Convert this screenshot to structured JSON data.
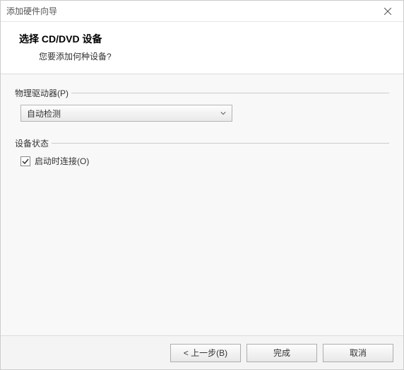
{
  "window": {
    "title": "添加硬件向导"
  },
  "header": {
    "title": "选择 CD/DVD 设备",
    "subtitle": "您要添加何种设备?"
  },
  "groups": {
    "physicalDrive": {
      "label": "物理驱动器(P)",
      "selected": "自动检测"
    },
    "deviceStatus": {
      "label": "设备状态",
      "connectOnStartup": "启动时连接(O)"
    }
  },
  "footer": {
    "back": "< 上一步(B)",
    "finish": "完成",
    "cancel": "取消"
  }
}
